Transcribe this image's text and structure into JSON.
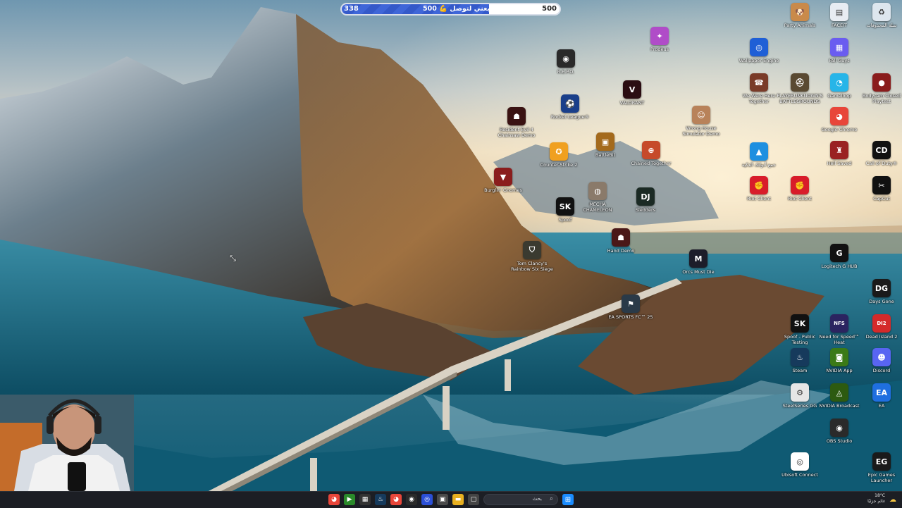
{
  "stream_goal": {
    "current": "338",
    "label": "تابعني لتوصل",
    "label_number": "500",
    "total": "500",
    "progress": 0.676
  },
  "desktop_icons": [
    {
      "label": "Party Animals",
      "icon": "dog-icon",
      "color": "#c98a4a",
      "glyph": "🐶"
    },
    {
      "label": "FACEIT",
      "icon": "document-icon",
      "color": "#e8ecf2",
      "glyph": "▤"
    },
    {
      "label": "سلة المحذوفات",
      "icon": "recycle-bin-icon",
      "color": "#dde6ee",
      "glyph": "♻"
    },
    {
      "label": "Wallpaper Engine",
      "icon": "wallpaper-engine-icon",
      "color": "#1f5fd6",
      "glyph": "◎"
    },
    {
      "label": "Fall Guys",
      "icon": "fall-guys-icon",
      "color": "#6a5cf0",
      "glyph": "▦"
    },
    {
      "label": "Prodeus",
      "icon": "prodeus-icon",
      "color": "#b04cc8",
      "glyph": "✦"
    },
    {
      "label": "R.E.P.O.",
      "icon": "repo-icon",
      "color": "#2a2a2a",
      "glyph": "◉"
    },
    {
      "label": "We Were Here Together",
      "icon": "walkie-icon",
      "color": "#7a3b28",
      "glyph": "☎"
    },
    {
      "label": "PLAYERUNKNOWN'S BATTLEGROUNDS",
      "icon": "pubg-icon",
      "color": "#5a4a32",
      "glyph": "⛑"
    },
    {
      "label": "Gameloop",
      "icon": "gameloop-icon",
      "color": "#27b5e8",
      "glyph": "◔"
    },
    {
      "label": "Bodycam Closed Playtest",
      "icon": "bodycam-icon",
      "color": "#8a1c1c",
      "glyph": "●"
    },
    {
      "label": "VALORANT",
      "icon": "valorant-icon",
      "color": "#2b0d12",
      "glyph": "V"
    },
    {
      "label": "Rocket League®",
      "icon": "rocket-league-icon",
      "color": "#1a3f8a",
      "glyph": "⚽"
    },
    {
      "label": "Resident Evil 4 Chainsaw Demo",
      "icon": "re4-icon",
      "color": "#3a1212",
      "glyph": "☗"
    },
    {
      "label": "Wrong House Simulator Demo",
      "icon": "face-icon",
      "color": "#b8825a",
      "glyph": "☺"
    },
    {
      "label": "Google Chrome",
      "icon": "chrome-icon",
      "color": "#e8463a",
      "glyph": "◕"
    },
    {
      "label": "BattleBit",
      "icon": "battlebit-icon",
      "color": "#a46a1c",
      "glyph": "▣"
    },
    {
      "label": "Chained Together",
      "icon": "chained-together-icon",
      "color": "#c64a2a",
      "glyph": "⊕"
    },
    {
      "label": "Counter-Strike 2",
      "icon": "cs2-icon",
      "color": "#f0a020",
      "glyph": "✪"
    },
    {
      "label": "جمع أدواتك الذكية",
      "icon": "photos-icon",
      "color": "#1d8fe0",
      "glyph": "▲"
    },
    {
      "label": "Hell Saved",
      "icon": "hell-icon",
      "color": "#9a2222",
      "glyph": "♜"
    },
    {
      "label": "Call of Duty®",
      "icon": "cod-icon",
      "color": "#111111",
      "glyph": "CD"
    },
    {
      "label": "Burglin' Gnomes",
      "icon": "gnome-icon",
      "color": "#8a1d1d",
      "glyph": "▼"
    },
    {
      "label": "Riot Client",
      "icon": "riot-icon",
      "color": "#d81c2a",
      "glyph": "✊"
    },
    {
      "label": "Riot Client",
      "icon": "riot-icon",
      "color": "#d81c2a",
      "glyph": "✊"
    },
    {
      "label": "CapCut",
      "icon": "capcut-icon",
      "color": "#111111",
      "glyph": "✂"
    },
    {
      "label": "MECHA CHAMELEON",
      "icon": "chameleon-icon",
      "color": "#8a7a6a",
      "glyph": "◍"
    },
    {
      "label": "Sledders",
      "icon": "sledders-icon",
      "color": "#1b2a24",
      "glyph": "DJ"
    },
    {
      "label": "Spoof",
      "icon": "sk-icon",
      "color": "#111111",
      "glyph": "SK"
    },
    {
      "label": "Hand Demo",
      "icon": "hand-icon",
      "color": "#4a1818",
      "glyph": "☗"
    },
    {
      "label": "Tom Clancy's Rainbow Six Siege",
      "icon": "r6-icon",
      "color": "#3a3a30",
      "glyph": "⛉"
    },
    {
      "label": "Orcs Must Die",
      "icon": "m-logo-icon",
      "color": "#1d1d2a",
      "glyph": "M"
    },
    {
      "label": "Logitech G HUB",
      "icon": "logitech-icon",
      "color": "#111111",
      "glyph": "G"
    },
    {
      "label": "Days Gone",
      "icon": "days-gone-icon",
      "color": "#1a1a1a",
      "glyph": "DG"
    },
    {
      "label": "EA SPORTS FC™ 25",
      "icon": "fc25-icon",
      "color": "#2a3a48",
      "glyph": "⚑"
    },
    {
      "label": "Spoof - Public Testing",
      "icon": "sk-icon",
      "color": "#111111",
      "glyph": "SK"
    },
    {
      "label": "Need for Speed™ Heat",
      "icon": "nfs-icon",
      "color": "#2b2460",
      "glyph": "NFS"
    },
    {
      "label": "Dead Island 2",
      "icon": "dead-island-icon",
      "color": "#d42a2a",
      "glyph": "DI2"
    },
    {
      "label": "Steam",
      "icon": "steam-icon",
      "color": "#163a5c",
      "glyph": "♨"
    },
    {
      "label": "NVIDIA App",
      "icon": "nvidia-icon",
      "color": "#3b7a17",
      "glyph": "◙"
    },
    {
      "label": "Discord",
      "icon": "discord-icon",
      "color": "#5865f2",
      "glyph": "☻"
    },
    {
      "label": "SteelSeries GG",
      "icon": "steelseries-icon",
      "color": "#e6e6e6",
      "glyph": "⚙"
    },
    {
      "label": "NVIDIA Broadcast",
      "icon": "nvidia-broadcast-icon",
      "color": "#2d5a10",
      "glyph": "◬"
    },
    {
      "label": "EA",
      "icon": "ea-icon",
      "color": "#1f6fe0",
      "glyph": "EA"
    },
    {
      "label": "OBS Studio",
      "icon": "obs-icon",
      "color": "#2a2a2a",
      "glyph": "◉"
    },
    {
      "label": "Ubisoft Connect",
      "icon": "ubisoft-icon",
      "color": "#ffffff",
      "glyph": "◎"
    },
    {
      "label": "Epic Games Launcher",
      "icon": "epic-games-icon",
      "color": "#1a1a1a",
      "glyph": "EG"
    }
  ],
  "taskbar": {
    "search_placeholder": "بحث",
    "apps": [
      {
        "name": "chrome-taskbar-icon",
        "color": "#e8463a",
        "glyph": "◕"
      },
      {
        "name": "play-taskbar-icon",
        "color": "#2a8a2a",
        "glyph": "▶"
      },
      {
        "name": "grid-taskbar-icon",
        "color": "#333333",
        "glyph": "▦"
      },
      {
        "name": "steam-taskbar-icon",
        "color": "#163a5c",
        "glyph": "♨"
      },
      {
        "name": "google-taskbar-icon",
        "color": "#e8463a",
        "glyph": "◕"
      },
      {
        "name": "obs-taskbar-icon",
        "color": "#2a2a2a",
        "glyph": "◉"
      },
      {
        "name": "app-taskbar-icon",
        "color": "#2b4fd6",
        "glyph": "◎"
      },
      {
        "name": "store-taskbar-icon",
        "color": "#4a4a4a",
        "glyph": "▣"
      },
      {
        "name": "folder-taskbar-icon",
        "color": "#e8b020",
        "glyph": "▬"
      },
      {
        "name": "window-taskbar-icon",
        "color": "#444444",
        "glyph": "▢"
      }
    ],
    "tray_temp": "18°C",
    "tray_status": "غائم جزئيًا"
  }
}
